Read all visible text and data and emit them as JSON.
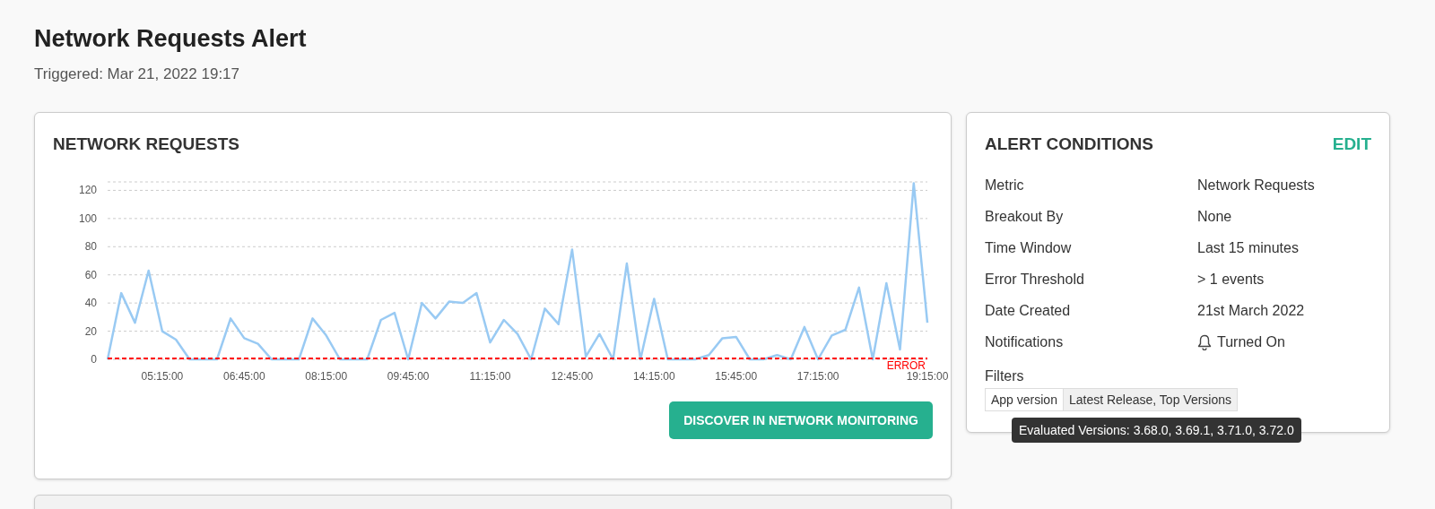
{
  "page": {
    "title": "Network Requests Alert",
    "subtitle": "Triggered: Mar 21, 2022 19:17"
  },
  "chart_card": {
    "title": "NETWORK REQUESTS",
    "button": "DISCOVER IN NETWORK MONITORING",
    "chart_data": {
      "type": "line",
      "x": [
        255,
        270,
        285,
        300,
        315,
        330,
        345,
        360,
        375,
        390,
        405,
        420,
        435,
        450,
        465,
        480,
        495,
        510,
        525,
        540,
        555,
        570,
        585,
        600,
        615,
        630,
        645,
        660,
        675,
        690,
        705,
        720,
        735,
        750,
        765,
        780,
        795,
        810,
        825,
        840,
        855,
        870,
        885,
        900,
        915,
        930,
        945,
        960,
        975,
        990,
        1005,
        1020,
        1035,
        1050,
        1065,
        1080,
        1095,
        1110,
        1125,
        1140,
        1155
      ],
      "series": [
        {
          "color": "#99caf3",
          "values": [
            0,
            47,
            26,
            63,
            20,
            14,
            0,
            0,
            0,
            29,
            15,
            11,
            0,
            0,
            0,
            29,
            17,
            0,
            0,
            0,
            28,
            33,
            0,
            40,
            29,
            41,
            40,
            47,
            12,
            28,
            18,
            0,
            36,
            25,
            78,
            2,
            18,
            0,
            68,
            0,
            43,
            0,
            0,
            0,
            3,
            15,
            16,
            0,
            0,
            3,
            0,
            23,
            0,
            17,
            21,
            51,
            0,
            54,
            7,
            125,
            26
          ]
        }
      ],
      "xlim": [
        255,
        1155
      ],
      "ylim": [
        0,
        126
      ],
      "yticks": [
        0,
        20,
        40,
        60,
        80,
        100,
        120
      ],
      "grid": true,
      "xticks": [
        {
          "value": 315,
          "label": "05:15:00"
        },
        {
          "value": 405,
          "label": "06:45:00"
        },
        {
          "value": 495,
          "label": "08:15:00"
        },
        {
          "value": 585,
          "label": "09:45:00"
        },
        {
          "value": 675,
          "label": "11:15:00"
        },
        {
          "value": 765,
          "label": "12:45:00"
        },
        {
          "value": 855,
          "label": "14:15:00"
        },
        {
          "value": 945,
          "label": "15:45:00"
        },
        {
          "value": 1035,
          "label": "17:15:00"
        },
        {
          "value": 1155,
          "label": "19:15:00"
        }
      ],
      "ref_lines": [
        {
          "label": "ERROR",
          "color": "#ff0000"
        }
      ]
    }
  },
  "conditions": {
    "title": "ALERT CONDITIONS",
    "edit": "EDIT",
    "rows": [
      {
        "label": "Metric",
        "value": "Network Requests",
        "icon": false
      },
      {
        "label": "Breakout By",
        "value": "None",
        "icon": false
      },
      {
        "label": "Time Window",
        "value": "Last 15 minutes",
        "icon": false
      },
      {
        "label": "Error Threshold",
        "value": "> 1 events",
        "icon": false
      },
      {
        "label": "Date Created",
        "value": "21st March 2022",
        "icon": false
      },
      {
        "label": "Notifications",
        "value": "Turned On",
        "icon": true
      }
    ],
    "filters_label": "Filters",
    "filter": {
      "key": "App version",
      "value": "Latest Release, Top Versions"
    },
    "tooltip": "Evaluated Versions: 3.68.0, 3.69.1, 3.71.0, 3.72.0"
  }
}
